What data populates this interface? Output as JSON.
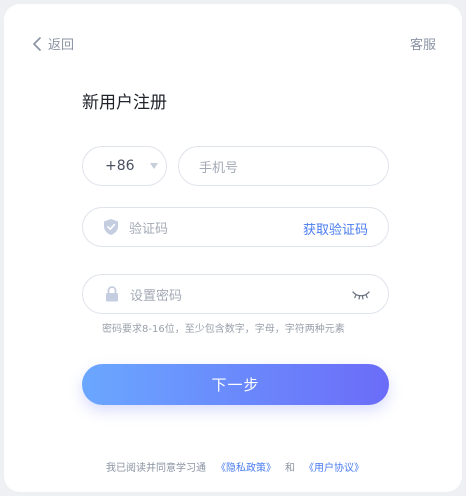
{
  "nav": {
    "back_label": "返回",
    "service_label": "客服"
  },
  "page": {
    "title": "新用户注册"
  },
  "form": {
    "country_code": "+86",
    "phone_placeholder": "手机号",
    "code_placeholder": "验证码",
    "get_code_label": "获取验证码",
    "password_placeholder": "设置密码",
    "password_hint": "密码要求8-16位，至少包含数字，字母，字符两种元素"
  },
  "actions": {
    "next_label": "下一步"
  },
  "agreement": {
    "prefix": "我已阅读并同意学习通",
    "privacy_link": "《隐私政策》",
    "and": "和",
    "user_link": "《用户协议》"
  },
  "colors": {
    "accent": "#4a7cf0",
    "button_gradient_start": "#6aa7ff",
    "button_gradient_end": "#6b6cf8"
  },
  "icons": [
    "chevron-left-icon",
    "caret-down-icon",
    "shield-check-icon",
    "lock-icon",
    "eye-closed-icon"
  ]
}
